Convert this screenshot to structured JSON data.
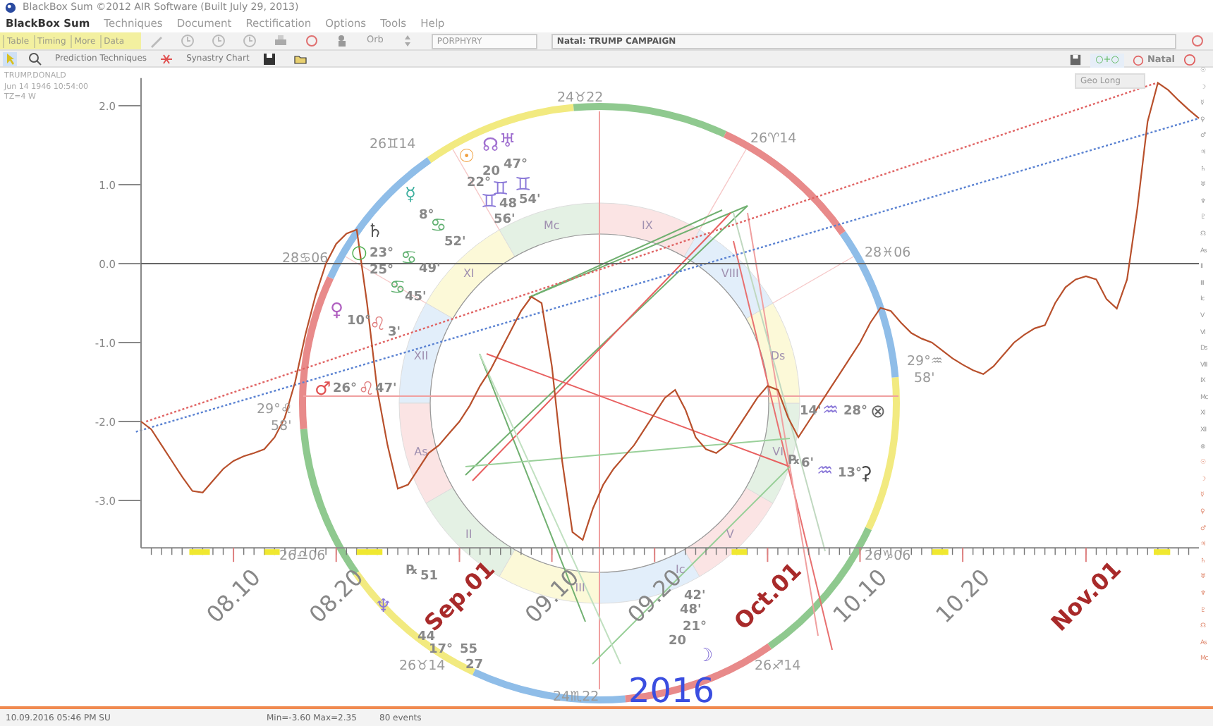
{
  "window": {
    "title": "BlackBox Sum ©2012 AIR Software (Built July 29, 2013)"
  },
  "menu": {
    "app_name": "BlackBox Sum",
    "items": [
      "Techniques",
      "Document",
      "Rectification",
      "Options",
      "Tools",
      "Help"
    ]
  },
  "toolbar": {
    "tabs": [
      "Table",
      "Timing",
      "More",
      "Data"
    ],
    "orb_label": "Orb",
    "house_system": "PORPHYRY",
    "chart_name": "Natal: TRUMP CAMPAIGN"
  },
  "toolbar2": {
    "buttons": [
      "Prediction Techniques",
      "Synastry Chart"
    ]
  },
  "right_panel": {
    "combine_label": "○+○",
    "natal_label": "Natal"
  },
  "person": {
    "name": "TRUMP.DONALD",
    "birth": "Jun 14 1946 10:54:00",
    "zone": "TZ=4 W"
  },
  "graph": {
    "year_label": "2016",
    "label_emphasis": [
      false,
      false,
      true,
      false,
      false,
      true,
      false,
      false,
      true
    ],
    "chart_data": {
      "type": "line",
      "ylim": [
        -3.6,
        2.35
      ],
      "yticks": [
        {
          "value": 2,
          "label": "2.0"
        },
        {
          "value": 1,
          "label": "1.0"
        },
        {
          "value": 0,
          "label": "0.0"
        },
        {
          "value": -1,
          "label": "-1.0"
        },
        {
          "value": -2,
          "label": "-2.0"
        },
        {
          "value": -3,
          "label": "-3.0"
        }
      ],
      "categories": [
        null,
        null,
        null,
        null,
        null,
        null,
        null,
        null,
        null,
        "08.10",
        null,
        null,
        null,
        null,
        null,
        null,
        null,
        null,
        null,
        "08.20",
        null,
        null,
        null,
        null,
        null,
        null,
        null,
        null,
        null,
        null,
        null,
        "Sep.01",
        null,
        null,
        null,
        null,
        null,
        null,
        null,
        null,
        "09.10",
        null,
        null,
        null,
        null,
        null,
        null,
        null,
        null,
        null,
        "09.20",
        null,
        null,
        null,
        null,
        null,
        null,
        null,
        null,
        null,
        null,
        "Oct.01",
        null,
        null,
        null,
        null,
        null,
        null,
        null,
        null,
        "10.10",
        null,
        null,
        null,
        null,
        null,
        null,
        null,
        null,
        null,
        "10.20",
        null,
        null,
        null,
        null,
        null,
        null,
        null,
        null,
        null,
        null,
        null,
        "Nov.01",
        null,
        null,
        null,
        null,
        null,
        null,
        null,
        null,
        null,
        null,
        null
      ],
      "series": [
        {
          "name": "Geo Long",
          "color": "#b8502c",
          "values": [
            -2.0,
            -2.1,
            -2.3,
            -2.5,
            -2.7,
            -2.88,
            -2.9,
            -2.75,
            -2.6,
            -2.5,
            -2.44,
            -2.4,
            -2.35,
            -2.2,
            -1.95,
            -1.5,
            -0.9,
            -0.4,
            0.0,
            0.25,
            0.38,
            0.43,
            -0.5,
            -1.6,
            -2.3,
            -2.85,
            -2.8,
            -2.6,
            -2.4,
            -2.3,
            -2.15,
            -2.0,
            -1.8,
            -1.55,
            -1.35,
            -1.1,
            -0.85,
            -0.6,
            -0.42,
            -0.5,
            -1.3,
            -2.5,
            -3.4,
            -3.5,
            -3.1,
            -2.8,
            -2.6,
            -2.45,
            -2.3,
            -2.1,
            -1.9,
            -1.7,
            -1.6,
            -1.85,
            -2.2,
            -2.35,
            -2.4,
            -2.3,
            -2.1,
            -1.9,
            -1.7,
            -1.55,
            -1.6,
            -1.95,
            -2.2,
            -2.0,
            -1.8,
            -1.6,
            -1.4,
            -1.2,
            -1.0,
            -0.75,
            -0.56,
            -0.6,
            -0.75,
            -0.88,
            -0.95,
            -1.0,
            -1.1,
            -1.2,
            -1.28,
            -1.35,
            -1.4,
            -1.3,
            -1.15,
            -1.0,
            -0.9,
            -0.82,
            -0.78,
            -0.5,
            -0.3,
            -0.2,
            -0.16,
            -0.2,
            -0.45,
            -0.57,
            -0.2,
            0.7,
            1.8,
            2.29,
            2.2,
            2.07,
            1.95,
            1.84
          ]
        }
      ]
    }
  },
  "wheel": {
    "labels": [
      {
        "text": "24♉22",
        "kind": "cusp"
      },
      {
        "text": "26♊14",
        "kind": "cusp"
      },
      {
        "text": "26♈14",
        "kind": "cusp"
      },
      {
        "text": "28♋06",
        "kind": "cusp"
      },
      {
        "text": "28♓06",
        "kind": "cusp"
      },
      {
        "text": "29°♌",
        "kind": "cusp"
      },
      {
        "text": "58'",
        "kind": "cusp"
      },
      {
        "text": "29°♒",
        "kind": "cusp"
      },
      {
        "text": "58'",
        "kind": "cusp"
      },
      {
        "text": "26♎06",
        "kind": "cusp"
      },
      {
        "text": "26♑06",
        "kind": "cusp"
      },
      {
        "text": "26♉14",
        "kind": "cusp"
      },
      {
        "text": "26♐14",
        "kind": "cusp"
      },
      {
        "text": "24♏22",
        "kind": "cusp"
      },
      {
        "text": "☉",
        "kind": "glyph",
        "color": "#f0a040"
      },
      {
        "text": "☊",
        "kind": "glyph",
        "color": "#a070d0"
      },
      {
        "text": "♅",
        "kind": "glyph",
        "color": "#a070d0"
      },
      {
        "text": "20",
        "kind": "degree"
      },
      {
        "text": "47°",
        "kind": "degree"
      },
      {
        "text": "22°",
        "kind": "degree"
      },
      {
        "text": "♊",
        "kind": "glyph",
        "color": "#8a78d8"
      },
      {
        "text": "♊",
        "kind": "glyph",
        "color": "#8a78d8"
      },
      {
        "text": "♊",
        "kind": "glyph",
        "color": "#8a78d8"
      },
      {
        "text": "48",
        "kind": "degree"
      },
      {
        "text": "54'",
        "kind": "degree"
      },
      {
        "text": "56'",
        "kind": "degree"
      },
      {
        "text": "☿",
        "kind": "glyph",
        "color": "#40b0a0"
      },
      {
        "text": "8°",
        "kind": "degree"
      },
      {
        "text": "♋",
        "kind": "glyph",
        "color": "#60b070"
      },
      {
        "text": "52'",
        "kind": "degree"
      },
      {
        "text": "♄",
        "kind": "glyph",
        "color": "#555555"
      },
      {
        "text": "○",
        "kind": "glyph",
        "color": "#50b050"
      },
      {
        "text": "23°",
        "kind": "degree"
      },
      {
        "text": "25°",
        "kind": "degree"
      },
      {
        "text": "♋",
        "kind": "glyph",
        "color": "#60b070"
      },
      {
        "text": "49'",
        "kind": "degree"
      },
      {
        "text": "♋",
        "kind": "glyph",
        "color": "#60b070"
      },
      {
        "text": "45'",
        "kind": "degree"
      },
      {
        "text": "♀",
        "kind": "glyph",
        "color": "#b060c0"
      },
      {
        "text": "10°",
        "kind": "degree"
      },
      {
        "text": "♌",
        "kind": "glyph",
        "color": "#e08080"
      },
      {
        "text": "3'",
        "kind": "degree"
      },
      {
        "text": "♂",
        "kind": "glyph",
        "color": "#e05050"
      },
      {
        "text": "26°",
        "kind": "degree"
      },
      {
        "text": "♌",
        "kind": "glyph",
        "color": "#e08080"
      },
      {
        "text": "47'",
        "kind": "degree"
      },
      {
        "text": "14'",
        "kind": "degree"
      },
      {
        "text": "♒",
        "kind": "glyph",
        "color": "#8a78d8"
      },
      {
        "text": "28°",
        "kind": "degree"
      },
      {
        "text": "⊗",
        "kind": "glyph",
        "color": "#666666"
      },
      {
        "text": "℞",
        "kind": "degree"
      },
      {
        "text": "6'",
        "kind": "degree"
      },
      {
        "text": "♒",
        "kind": "glyph",
        "color": "#8a78d8"
      },
      {
        "text": "13°",
        "kind": "degree"
      },
      {
        "text": "⚳",
        "kind": "glyph",
        "color": "#444444"
      },
      {
        "text": "℞",
        "kind": "degree"
      },
      {
        "text": "51",
        "kind": "degree"
      },
      {
        "text": "♆",
        "kind": "glyph",
        "color": "#8a78d8"
      },
      {
        "text": "55",
        "kind": "degree"
      },
      {
        "text": "27",
        "kind": "degree"
      },
      {
        "text": "44",
        "kind": "degree"
      },
      {
        "text": "17°",
        "kind": "degree"
      },
      {
        "text": "42'",
        "kind": "degree"
      },
      {
        "text": "48'",
        "kind": "degree"
      },
      {
        "text": "21°",
        "kind": "degree"
      },
      {
        "text": "20",
        "kind": "degree"
      },
      {
        "text": "☽",
        "kind": "glyph",
        "color": "#8a78d8"
      }
    ],
    "houses": [
      "Mc",
      "XI",
      "XII",
      "As",
      "II",
      "III",
      "Ic",
      "V",
      "VI",
      "Ds",
      "VIII",
      "IX"
    ]
  },
  "side_points": [
    {
      "text": "☉",
      "transit": false
    },
    {
      "text": "☽",
      "transit": false
    },
    {
      "text": "☿",
      "transit": false
    },
    {
      "text": "♀",
      "transit": false
    },
    {
      "text": "♂",
      "transit": false
    },
    {
      "text": "♃",
      "transit": false
    },
    {
      "text": "♄",
      "transit": false
    },
    {
      "text": "♅",
      "transit": false
    },
    {
      "text": "♆",
      "transit": false
    },
    {
      "text": "♇",
      "transit": false
    },
    {
      "text": "☊",
      "transit": false
    },
    {
      "text": "As",
      "transit": false
    },
    {
      "text": "II",
      "transit": false
    },
    {
      "text": "III",
      "transit": false
    },
    {
      "text": "Ic",
      "transit": false
    },
    {
      "text": "V",
      "transit": false
    },
    {
      "text": "VI",
      "transit": false
    },
    {
      "text": "Ds",
      "transit": false
    },
    {
      "text": "VIII",
      "transit": false
    },
    {
      "text": "IX",
      "transit": false
    },
    {
      "text": "Mc",
      "transit": false
    },
    {
      "text": "XI",
      "transit": false
    },
    {
      "text": "XII",
      "transit": false
    },
    {
      "text": "⊗",
      "transit": false
    },
    {
      "text": "☉",
      "transit": true
    },
    {
      "text": "☽",
      "transit": true
    },
    {
      "text": "☿",
      "transit": true
    },
    {
      "text": "♀",
      "transit": true
    },
    {
      "text": "♂",
      "transit": true
    },
    {
      "text": "♃",
      "transit": true
    },
    {
      "text": "♄",
      "transit": true
    },
    {
      "text": "♅",
      "transit": true
    },
    {
      "text": "♆",
      "transit": true
    },
    {
      "text": "♇",
      "transit": true
    },
    {
      "text": "☊",
      "transit": true
    },
    {
      "text": "As",
      "transit": true
    },
    {
      "text": "Mc",
      "transit": true
    }
  ],
  "status_bar": {
    "datetime": "10.09.2016 05:46 PM SU",
    "range": "Min=-3.60 Max=2.35",
    "events": "80 events"
  }
}
